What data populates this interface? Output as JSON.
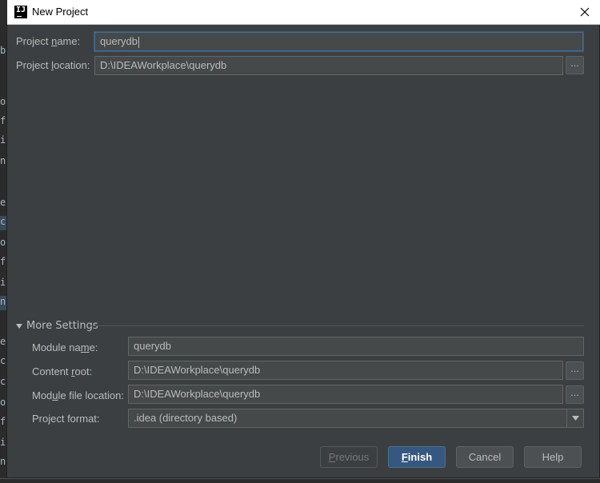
{
  "window": {
    "title": "New Project",
    "app_icon_text": "IJ"
  },
  "form": {
    "project_name": {
      "label_pre": "Project ",
      "label_mn": "n",
      "label_post": "ame:",
      "value": "querydb"
    },
    "project_location": {
      "label_pre": "Project ",
      "label_mn": "l",
      "label_post": "ocation:",
      "value": "D:\\IDEAWorkplace\\querydb",
      "browse_label": "..."
    }
  },
  "more_settings": {
    "label": "More Settings",
    "module_name": {
      "label_pre": "Module na",
      "label_mn": "m",
      "label_post": "e:",
      "value": "querydb"
    },
    "content_root": {
      "label_pre": "Content ",
      "label_mn": "r",
      "label_post": "oot:",
      "value": "D:\\IDEAWorkplace\\querydb",
      "browse_label": "..."
    },
    "module_file_location": {
      "label_pre": "Mod",
      "label_mn": "u",
      "label_post": "le file location:",
      "value": "D:\\IDEAWorkplace\\querydb",
      "browse_label": "..."
    },
    "project_format": {
      "label": "Project format:",
      "value": ".idea (directory based)"
    }
  },
  "buttons": {
    "previous": {
      "mn": "P",
      "rest": "revious"
    },
    "finish": {
      "mn": "F",
      "rest": "inish"
    },
    "cancel": "Cancel",
    "help": "Help"
  },
  "colors": {
    "dialog_bg": "#3c3f41",
    "field_bg": "#45494a",
    "focus_border": "#466d94",
    "primary_button": "#365880"
  }
}
